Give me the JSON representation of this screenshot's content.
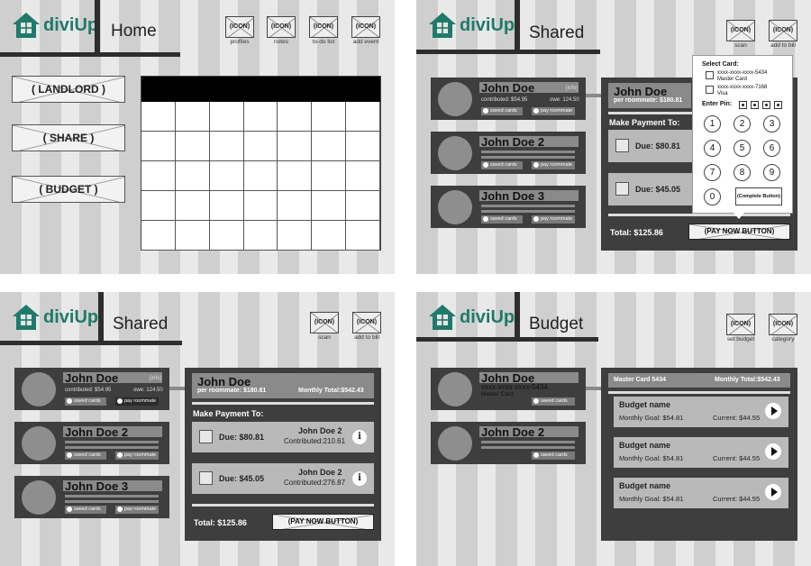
{
  "app": {
    "logo_text": "diviUp",
    "brand_color": "#1f7a6a"
  },
  "icon_placeholder": "(ICON)",
  "home": {
    "title": "Home",
    "icons": [
      "profiles",
      "notes",
      "to-do list",
      "add event"
    ],
    "buttons": [
      "( LANDLORD )",
      "( SHARE )",
      "( BUDGET )"
    ]
  },
  "shared_pay": {
    "title": "Shared",
    "icons": [
      "scan",
      "add to bill"
    ],
    "roommates": [
      {
        "name": "John Doe",
        "info": "[info]",
        "contributed": "contributed: $54.95",
        "owe": "owe: 124.50",
        "saved": "saved cards",
        "pay": "pay roommate"
      },
      {
        "name": "John Doe 2",
        "saved": "saved cards",
        "pay": "pay roommate"
      },
      {
        "name": "John Doe 3",
        "saved": "saved cards",
        "pay": "pay roommate"
      }
    ],
    "payee_name": "John Doe",
    "per_roommate": "per roommate: $180.81",
    "make_payment": "Make Payment To:",
    "dues": [
      "Due: $80.81",
      "Due: $45.05"
    ],
    "total": "Total: $125.86",
    "pay_now": "(PAY NOW BUTTON)",
    "popup": {
      "select_card": "Select Card:",
      "cards": [
        {
          "number": "xxxx-xxxx-xxxx-5434",
          "type": "Master Card"
        },
        {
          "number": "xxxx-xxxx-xxxx-7168",
          "type": "Visa"
        }
      ],
      "enter_pin": "Enter Pin:",
      "keys": [
        "1",
        "2",
        "3",
        "4",
        "5",
        "6",
        "7",
        "8",
        "9",
        "0"
      ],
      "complete": "(Complete Button)"
    }
  },
  "shared_summary": {
    "title": "Shared",
    "icons": [
      "scan",
      "add to bill"
    ],
    "roommates": [
      {
        "name": "John Doe",
        "info": "[info]",
        "contributed": "contributed: $54.95",
        "owe": "owe: 124.50",
        "saved": "saved cards",
        "pay": "pay roommate"
      },
      {
        "name": "John Doe 2",
        "saved": "saved cards",
        "pay": "pay roommate"
      },
      {
        "name": "John Doe 3",
        "saved": "saved cards",
        "pay": "pay roommate"
      }
    ],
    "payee_name": "John Doe",
    "per_roommate": "per roommate: $180.81",
    "monthly_total": "Monthly Total:$542.43",
    "make_payment": "Make Payment To:",
    "dues": [
      {
        "due": "Due: $80.81",
        "name": "John Doe 2",
        "contributed": "Contributed:210.61"
      },
      {
        "due": "Due: $45.05",
        "name": "John Doe 2",
        "contributed": "Contributed:276.87"
      }
    ],
    "total": "Total: $125.86",
    "pay_now": "(PAY NOW BUTTON)"
  },
  "budget": {
    "title": "Budget",
    "icons": [
      "set budget",
      "category"
    ],
    "accounts": [
      {
        "name": "John Doe",
        "card": "xxxx-xxxx-xxxx-5434",
        "type": "Master Card",
        "saved": "saved cards"
      },
      {
        "name": "John Doe 2",
        "saved": "saved cards"
      }
    ],
    "header_card": "Master Card 5434",
    "header_total": "Monthly Total:$542.43",
    "items": [
      {
        "name": "Budget name",
        "goal": "Monthly Goal: $54.81",
        "current": "Current: $44.55"
      },
      {
        "name": "Budget name",
        "goal": "Monthly Goal: $54.81",
        "current": "Current: $44.55"
      },
      {
        "name": "Budget name",
        "goal": "Monthly Goal: $54.81",
        "current": "Current: $44.55"
      }
    ]
  }
}
